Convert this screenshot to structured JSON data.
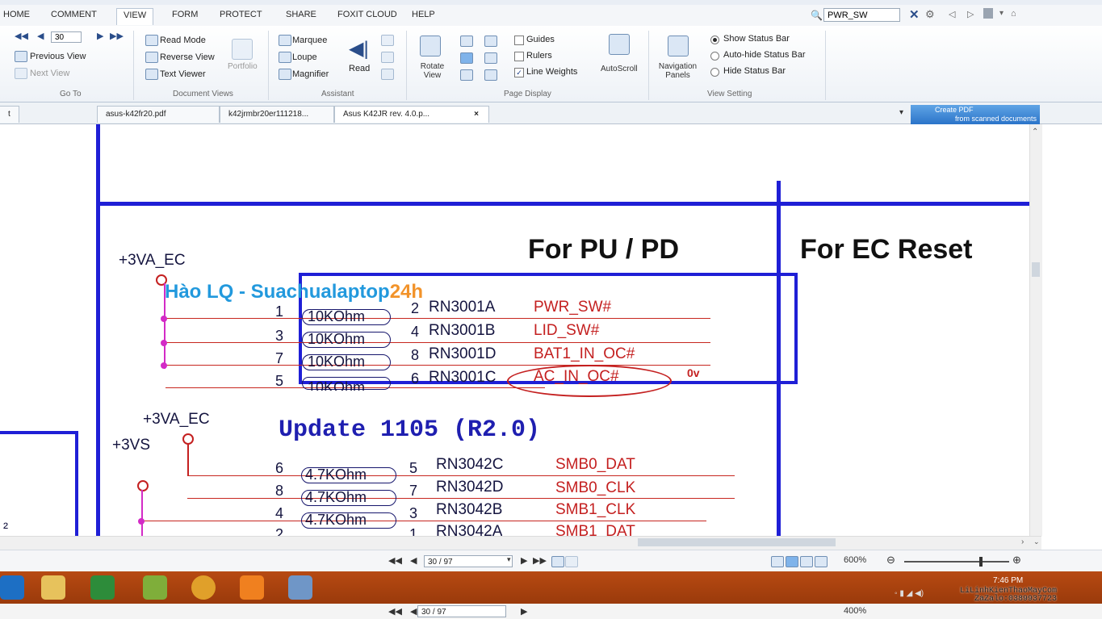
{
  "menu": {
    "items": [
      "HOME",
      "COMMENT",
      "VIEW",
      "FORM",
      "PROTECT",
      "SHARE",
      "FOXIT CLOUD",
      "HELP"
    ],
    "active": "VIEW"
  },
  "search": {
    "value": "PWR_SW"
  },
  "ribbon": {
    "goto": {
      "page": "30",
      "previous_view": "Previous View",
      "next_view": "Next View",
      "label": "Go To"
    },
    "document_views": {
      "read_mode": "Read Mode",
      "reverse_view": "Reverse View",
      "text_viewer": "Text Viewer",
      "portfolio": "Portfolio",
      "label": "Document Views"
    },
    "assistant": {
      "marquee": "Marquee",
      "loupe": "Loupe",
      "magnifier": "Magnifier",
      "read": "Read",
      "label": "Assistant"
    },
    "page_display": {
      "rotate_view": "Rotate View",
      "guides": "Guides",
      "rulers": "Rulers",
      "line_weights": "Line Weights",
      "autoscroll": "AutoScroll",
      "label": "Page Display"
    },
    "view_setting": {
      "navigation_panels": "Navigation Panels",
      "show_status_bar": "Show Status Bar",
      "auto_hide_status_bar": "Auto-hide Status Bar",
      "hide_status_bar": "Hide Status Bar",
      "label": "View Setting"
    }
  },
  "tabs": {
    "items": [
      "t",
      "asus-k42fr20.pdf",
      "k42jrmbr20er111218...",
      "Asus K42JR rev. 4.0.p..."
    ],
    "cloud_line1": "Create PDF",
    "cloud_line2": "from scanned documents"
  },
  "schematic": {
    "heading_pupd": "For PU / PD",
    "heading_ec_reset": "For EC Reset",
    "rail_3va_ec_1": "+3VA_EC",
    "rail_3va_ec_2": "+3VA_EC",
    "rail_3vs": "+3VS",
    "overlay_text_a": "Hào LQ - Suachualaptop",
    "overlay_text_b": "24h",
    "update_note": "Update 1105 (R2.0)",
    "voltage_note": "0v",
    "group1": [
      {
        "pin_left": "1",
        "value": "10KOhm",
        "pin_right": "2",
        "ref": "RN3001A",
        "net": "PWR_SW#"
      },
      {
        "pin_left": "3",
        "value": "10KOhm",
        "pin_right": "4",
        "ref": "RN3001B",
        "net": "LID_SW#"
      },
      {
        "pin_left": "7",
        "value": "10KOhm",
        "pin_right": "8",
        "ref": "RN3001D",
        "net": "BAT1_IN_OC#"
      },
      {
        "pin_left": "5",
        "value": "10KOhm",
        "pin_right": "6",
        "ref": "RN3001C",
        "net": "AC_IN_OC#"
      }
    ],
    "group2": [
      {
        "pin_left": "6",
        "value": "4.7KOhm",
        "pin_right": "5",
        "ref": "RN3042C",
        "net": "SMB0_DAT"
      },
      {
        "pin_left": "8",
        "value": "4.7KOhm",
        "pin_right": "7",
        "ref": "RN3042D",
        "net": "SMB0_CLK"
      },
      {
        "pin_left": "4",
        "value": "4.7KOhm",
        "pin_right": "3",
        "ref": "RN3042B",
        "net": "SMB1_CLK"
      },
      {
        "pin_left": "2",
        "value": "",
        "pin_right": "1",
        "ref": "RN3042A",
        "net": "SMB1_DAT"
      }
    ],
    "left_partial": "²"
  },
  "statusbar": {
    "page_display": "30 / 97",
    "zoom": "600%",
    "page_display_bg": "30 / 97",
    "zoom_bg": "400%"
  },
  "taskbar": {
    "time": "7:46 PM",
    "watermark_line1": "LiLinhKienThaoMayCom",
    "watermark_line2": "ZaZalo:0389937723"
  },
  "colors": {
    "schematic_blue": "#1f1fd6",
    "net_red": "#c42020",
    "node_magenta": "#d32bc6",
    "taskbar_orange": "#a8420f"
  }
}
